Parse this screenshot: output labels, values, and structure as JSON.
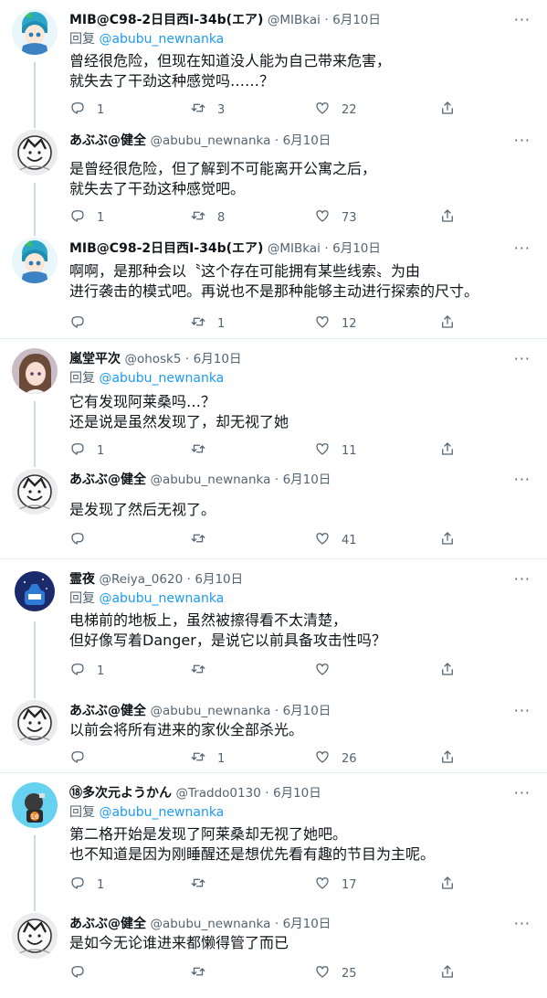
{
  "ui": {
    "reply_prefix": "回复",
    "more_glyph": "···",
    "dot": "·"
  },
  "tweets": [
    {
      "name": "MIB@C98-2日目西Ⅰ-34b(エア)",
      "handle": "@MIBkai",
      "date": "6月10日",
      "reply_to": "@abubu_newnanka",
      "text": "曾经很危险，但现在知道没人能为自己带来危害，\n就失去了干劲这种感觉吗……？",
      "replies": "1",
      "retweets": "3",
      "likes": "22"
    },
    {
      "name": "あぶぶ@健全",
      "handle": "@abubu_newnanka",
      "date": "6月10日",
      "text": "是曾经很危险，但了解到不可能离开公寓之后，\n就失去了干劲这种感觉吧。",
      "replies": "1",
      "retweets": "8",
      "likes": "73"
    },
    {
      "name": "MIB@C98-2日目西Ⅰ-34b(エア)",
      "handle": "@MIBkai",
      "date": "6月10日",
      "text": "啊啊，是那种会以〝这个存在可能拥有某些线索〟为由\n进行袭击的模式吧。再说也不是那种能够主动进行探索的尺寸。",
      "replies": "",
      "retweets": "1",
      "likes": "12"
    },
    {
      "name": "嵐堂平次",
      "handle": "@ohosk5",
      "date": "6月10日",
      "reply_to": "@abubu_newnanka",
      "text": "它有发现阿莱桑吗…？\n还是说是虽然发现了，却无视了她",
      "replies": "1",
      "retweets": "",
      "likes": "11"
    },
    {
      "name": "あぶぶ@健全",
      "handle": "@abubu_newnanka",
      "date": "6月10日",
      "text": "是发现了然后无视了。",
      "replies": "",
      "retweets": "",
      "likes": "41"
    },
    {
      "name": "霊夜",
      "handle": "@Reiya_0620",
      "date": "6月10日",
      "reply_to": "@abubu_newnanka",
      "text": "电梯前的地板上，虽然被擦得看不太清楚，\n但好像写着Danger，是说它以前具备攻击性吗？",
      "replies": "1",
      "retweets": "",
      "likes": ""
    },
    {
      "name": "あぶぶ@健全",
      "handle": "@abubu_newnanka",
      "date": "6月10日",
      "text": "以前会将所有进来的家伙全部杀光。",
      "replies": "",
      "retweets": "1",
      "likes": "26"
    },
    {
      "name": "⑱多次元ようかん",
      "handle": "@Traddo0130",
      "date": "6月10日",
      "reply_to": "@abubu_newnanka",
      "text": "第二格开始是发现了阿莱桑却无视了她吧。\n也不知道是因为刚睡醒还是想优先看有趣的节目为主呢。",
      "replies": "1",
      "retweets": "",
      "likes": "17"
    },
    {
      "name": "あぶぶ@健全",
      "handle": "@abubu_newnanka",
      "date": "6月10日",
      "text": "是如今无论谁进来都懒得管了而已",
      "replies": "",
      "retweets": "",
      "likes": "25"
    }
  ],
  "colors": {
    "accent": "#1d9bf0",
    "text": "#0f1419",
    "secondary": "#536471",
    "separator": "#e6ecf0"
  },
  "icons": [
    "reply-icon",
    "retweet-icon",
    "like-icon",
    "share-icon",
    "more-icon"
  ]
}
